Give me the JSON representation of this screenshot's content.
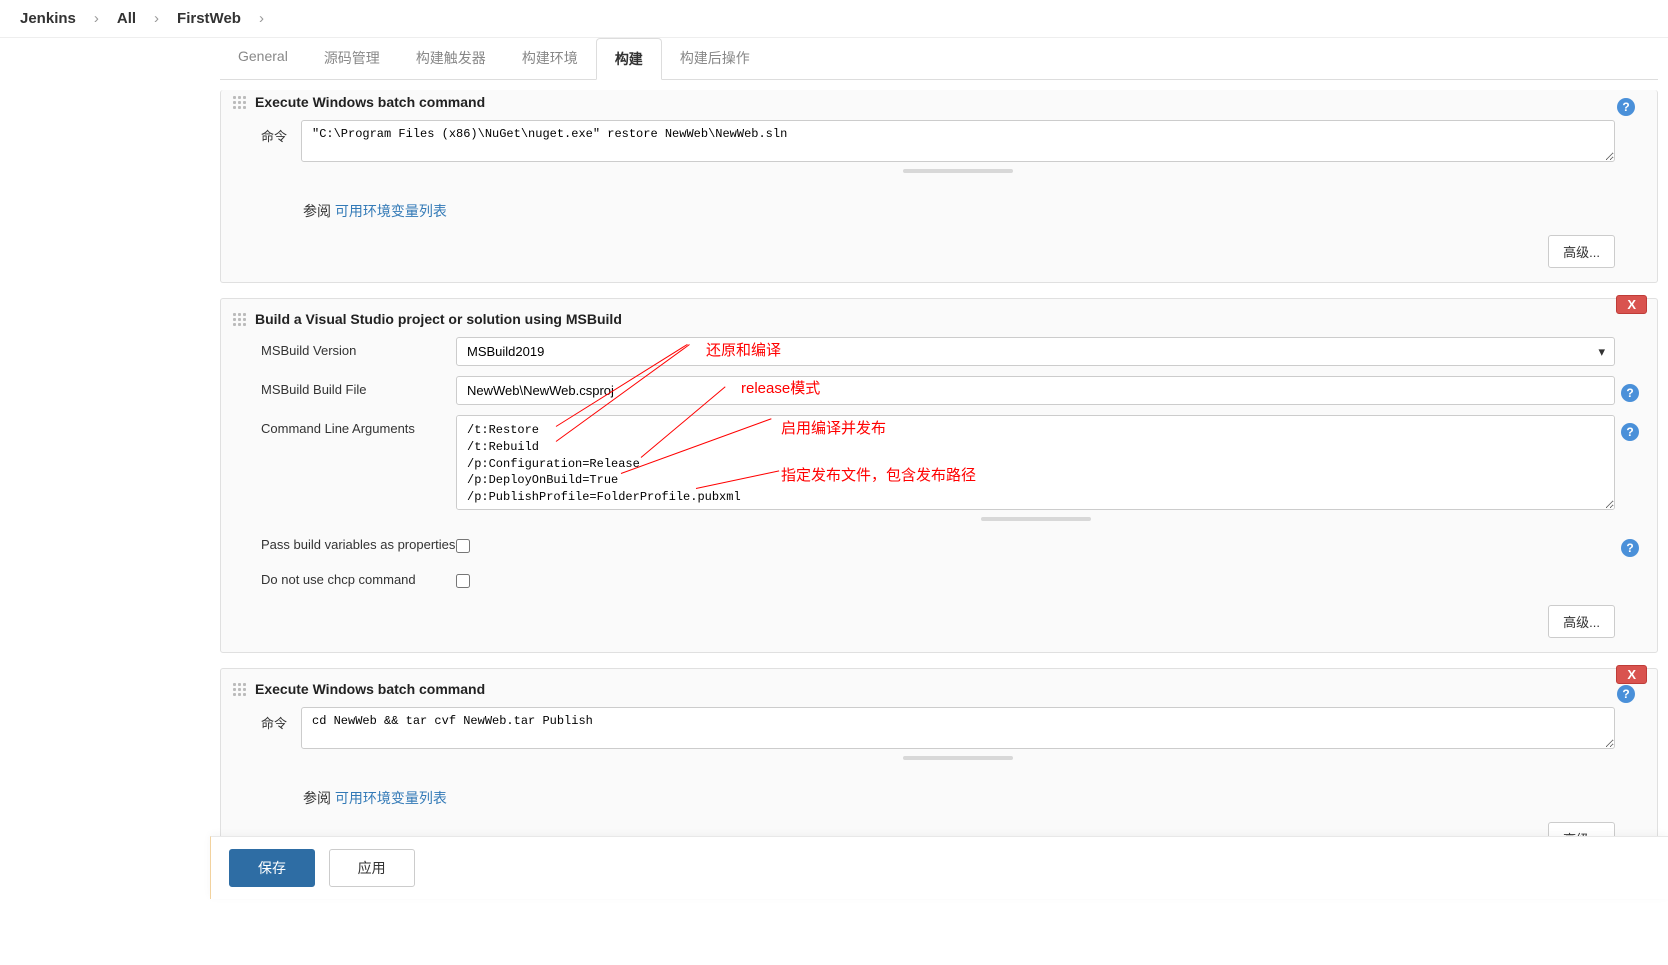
{
  "breadcrumb": {
    "jenkins": "Jenkins",
    "all": "All",
    "project": "FirstWeb"
  },
  "tabs": {
    "general": "General",
    "scm": "源码管理",
    "triggers": "构建触发器",
    "env": "构建环境",
    "build": "构建",
    "post": "构建后操作"
  },
  "sections": {
    "batch1": {
      "title": "Execute Windows batch command",
      "cmd_label": "命令",
      "cmd_value": "\"C:\\Program Files (x86)\\NuGet\\nuget.exe\" restore NewWeb\\NewWeb.sln",
      "ref_prefix": "参阅 ",
      "ref_link": "可用环境变量列表",
      "advanced": "高级..."
    },
    "msbuild": {
      "title": "Build a Visual Studio project or solution using MSBuild",
      "delete": "X",
      "version_label": "MSBuild Version",
      "version_value": "MSBuild2019",
      "file_label": "MSBuild Build File",
      "file_value": "NewWeb\\NewWeb.csproj",
      "args_label": "Command Line Arguments",
      "args_value": "/t:Restore\n/t:Rebuild\n/p:Configuration=Release\n/p:DeployOnBuild=True\n/p:PublishProfile=FolderProfile.pubxml",
      "passvars_label": "Pass build variables as properties",
      "nochcp_label": "Do not use chcp command",
      "advanced": "高级..."
    },
    "batch2": {
      "title": "Execute Windows batch command",
      "delete": "X",
      "cmd_label": "命令",
      "cmd_value": "cd NewWeb && tar cvf NewWeb.tar Publish",
      "ref_prefix": "参阅 ",
      "ref_link": "可用环境变量列表",
      "advanced": "高级..."
    }
  },
  "annotations": {
    "a1": "还原和编译",
    "a2": "release模式",
    "a3": "启用编译并发布",
    "a4": "指定发布文件，包含发布路径"
  },
  "footer": {
    "save": "保存",
    "apply": "应用"
  },
  "help": "?"
}
